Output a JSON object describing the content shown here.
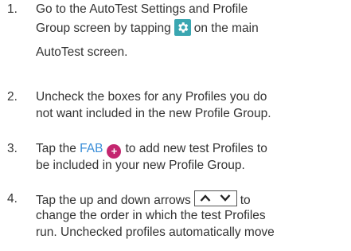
{
  "steps": [
    {
      "number": "1.",
      "lines": [
        "Go to the AutoTest Settings and Profile",
        "Group screen by tapping",
        "on the main",
        "AutoTest screen."
      ]
    },
    {
      "number": "2.",
      "lines": [
        "Uncheck the boxes for any Profiles you do",
        "not want included in the new Profile Group."
      ]
    },
    {
      "number": "3.",
      "lines": [
        "Tap the",
        "FAB",
        "to add new test Profiles to",
        "be included in your new Profile Group."
      ]
    },
    {
      "number": "4.",
      "lines": [
        "Tap the up and down arrows",
        "to",
        "change the order in which the test Profiles",
        "run. Unchecked profiles automatically move"
      ]
    }
  ],
  "icons": {
    "settings": "gear-icon",
    "fab": "add-icon",
    "fab_symbol": "+",
    "up": "chevron-up-icon",
    "down": "chevron-down-icon"
  },
  "colors": {
    "text": "#333333",
    "link": "#3a8ed8",
    "gear_bg": "#3aa6b1",
    "fab_bg": "#c4266f"
  }
}
